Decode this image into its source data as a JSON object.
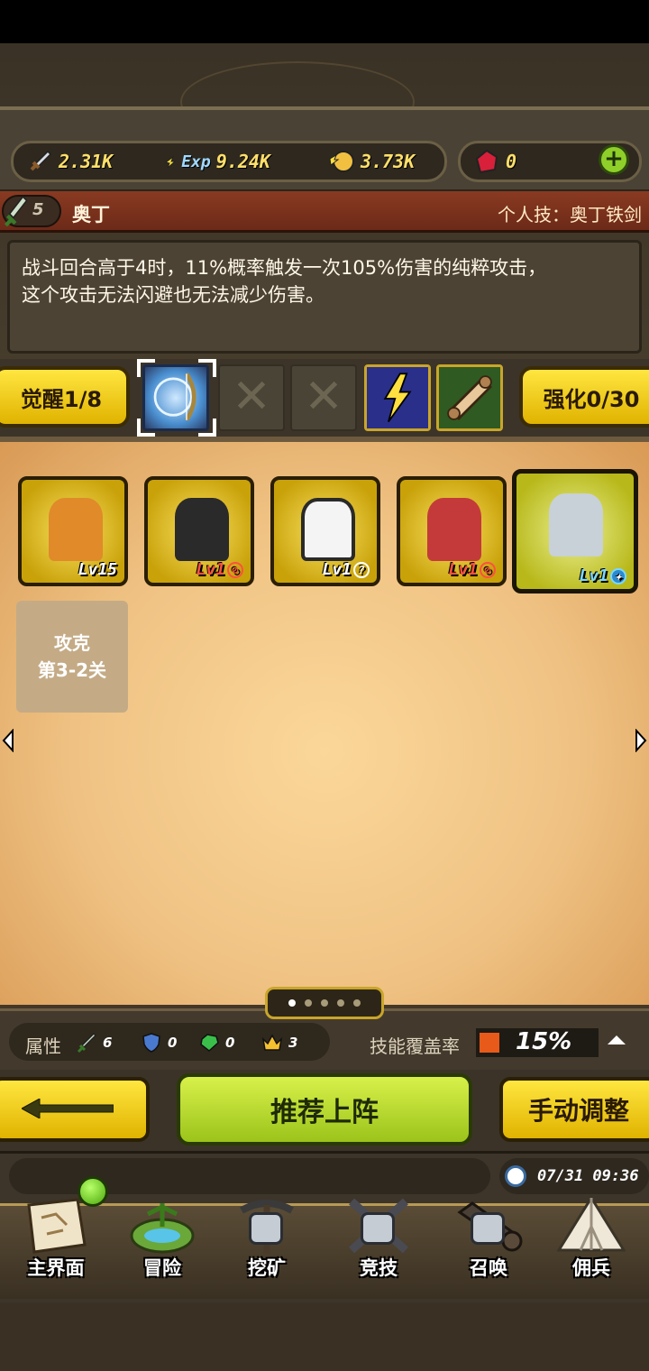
{
  "resources": {
    "attack": "2.31K",
    "exp_label": "Exp",
    "exp": "9.24K",
    "gold": "3.73K",
    "gems": "0"
  },
  "hero": {
    "level": "5",
    "name": "奥丁",
    "skill": "个人技：奥丁铁剑",
    "description_line1": "战斗回合高于4时，11%概率触发一次105%伤害的纯粹攻击，",
    "description_line2": "这个攻击无法闪避也无法减少伤害。"
  },
  "awaken": {
    "label": "觉醒1/8"
  },
  "enhance": {
    "label": "强化0/30"
  },
  "slots": {
    "empty_mark": "✕"
  },
  "roster": [
    {
      "level": "Lv15",
      "color": "#e08a2a"
    },
    {
      "level": "Lv1",
      "color": "#5a5a66"
    },
    {
      "level": "Lv1",
      "color": "#2a2a2a"
    },
    {
      "level": "Lv1",
      "color": "#c43a3a"
    },
    {
      "level": "Lv1",
      "color": "#c8d0d8"
    }
  ],
  "roster_marks": {
    "forbidden": "⊘",
    "unknown": "?",
    "star": "✦"
  },
  "locked_slot": {
    "line1": "攻克",
    "line2": "第3-2关"
  },
  "attributes": {
    "label": "属性",
    "sword": "6",
    "shield": "0",
    "gem": "0",
    "crown": "3",
    "coverage_label": "技能覆盖率",
    "coverage_value": "15%",
    "coverage_color": "#e85a1a"
  },
  "pager": {
    "total": 5,
    "current": 1
  },
  "actions": {
    "recommend": "推荐上阵",
    "manual": "手动调整"
  },
  "clock": {
    "time": "07/31 09:36"
  },
  "nav": [
    {
      "label": "主界面",
      "icon": "map-scroll-icon",
      "locked": false
    },
    {
      "label": "冒险",
      "icon": "island-icon",
      "locked": false
    },
    {
      "label": "挖矿",
      "icon": "pickaxe-icon",
      "locked": true
    },
    {
      "label": "竞技",
      "icon": "crossed-swords-icon",
      "locked": true
    },
    {
      "label": "召唤",
      "icon": "summon-scroll-icon",
      "locked": true
    },
    {
      "label": "佣兵",
      "icon": "tent-icon",
      "locked": false
    }
  ]
}
